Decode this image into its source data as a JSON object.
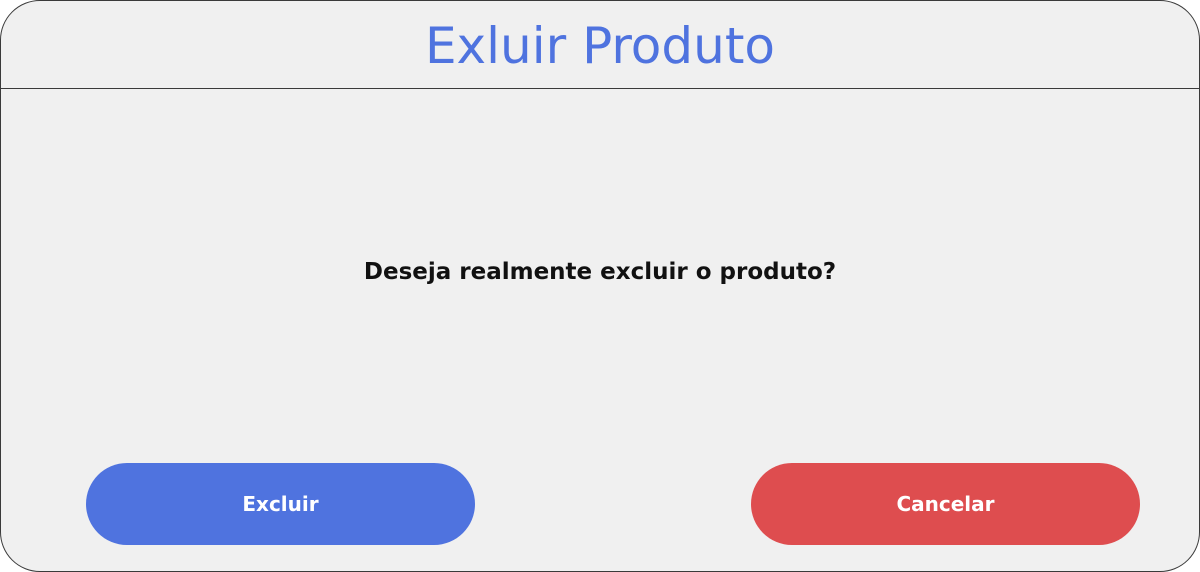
{
  "dialog": {
    "title": "Exluir Produto",
    "message": "Deseja realmente excluir o produto?",
    "buttons": {
      "delete_label": "Excluir",
      "cancel_label": "Cancelar"
    }
  },
  "colors": {
    "title": "#4f73df",
    "delete_button": "#4f73df",
    "cancel_button": "#de4d4f",
    "background": "#f0f0f0",
    "border": "#3a3a3a"
  }
}
